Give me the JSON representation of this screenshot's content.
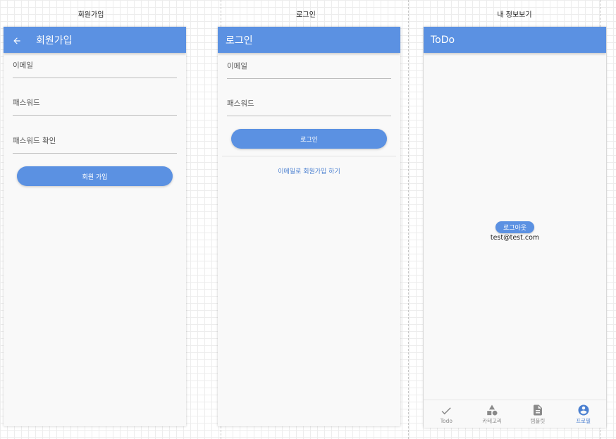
{
  "frames": {
    "signup_title": "회원가입",
    "login_title": "로그인",
    "profile_title": "내 정보보기"
  },
  "signup": {
    "appbar_title": "회원가입",
    "email_placeholder": "이메일",
    "password_placeholder": "패스워드",
    "password_confirm_placeholder": "패스워드 확인",
    "submit_label": "회원 가입"
  },
  "login": {
    "appbar_title": "로그인",
    "email_placeholder": "이메일",
    "password_placeholder": "패스워드",
    "submit_label": "로그인",
    "signup_link": "이메일로 회원가입 하기"
  },
  "profile": {
    "appbar_title": "ToDo",
    "logout_label": "로그아웃",
    "email": "test@test.com",
    "nav": [
      {
        "label": "Todo",
        "icon": "check-icon"
      },
      {
        "label": "카테고리",
        "icon": "category-icon"
      },
      {
        "label": "템플릿",
        "icon": "document-icon"
      },
      {
        "label": "프로필",
        "icon": "account-circle-icon"
      }
    ]
  },
  "colors": {
    "primary": "#5b91e2",
    "link": "#4a7fd0",
    "screen_bg": "#f9f9f9"
  }
}
